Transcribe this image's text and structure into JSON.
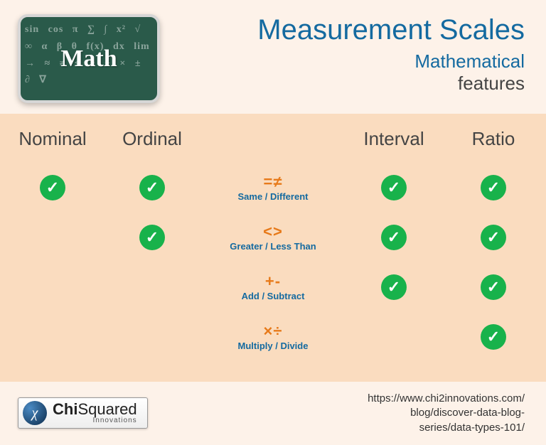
{
  "header": {
    "math_card_label": "Math",
    "title": "Measurement Scales",
    "subtitle1": "Mathematical",
    "subtitle2": "features"
  },
  "columns": [
    "Nominal",
    "Ordinal",
    "Interval",
    "Ratio"
  ],
  "operations": [
    {
      "symbol": "=≠",
      "label": "Same / Different"
    },
    {
      "symbol": "<>",
      "label": "Greater / Less Than"
    },
    {
      "symbol": "+-",
      "label": "Add / Subtract"
    },
    {
      "symbol": "×÷",
      "label": "Multiply / Divide"
    }
  ],
  "matrix": {
    "nominal": [
      true,
      false,
      false,
      false
    ],
    "ordinal": [
      true,
      true,
      false,
      false
    ],
    "interval": [
      true,
      true,
      true,
      false
    ],
    "ratio": [
      true,
      true,
      true,
      true
    ]
  },
  "footer": {
    "logo_chi": "χ",
    "logo_main_bold": "Chi",
    "logo_main_rest": "Squared",
    "logo_sub": "Innovations",
    "url_line1": "https://www.chi2innovations.com/",
    "url_line2": "blog/discover-data-blog-",
    "url_line3": "series/data-types-101/"
  },
  "checkmark": "✓"
}
